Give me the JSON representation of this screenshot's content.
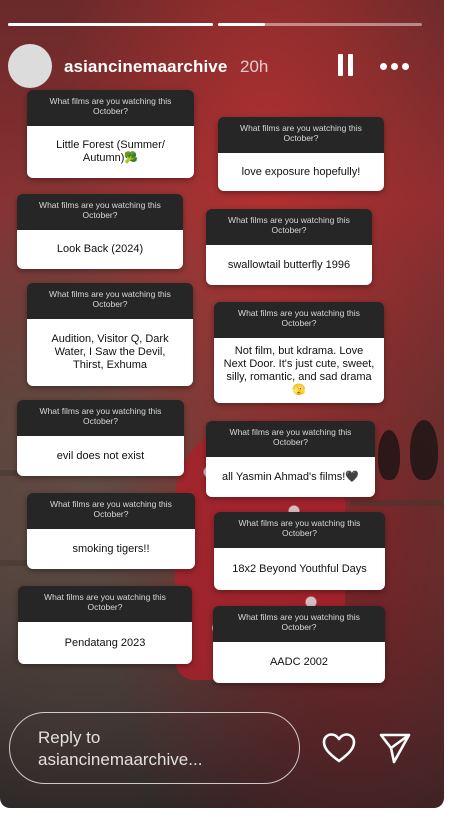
{
  "story": {
    "username": "asiancinemaarchive",
    "time_ago": "20h",
    "progress": [
      1.0,
      0.25
    ]
  },
  "question": "What films are you watching this October?",
  "cards": [
    {
      "answer": "Little Forest (Summer/ Autumn)🥦"
    },
    {
      "answer": "love exposure hopefully!"
    },
    {
      "answer": "Look Back (2024)"
    },
    {
      "answer": "swallowtail butterfly 1996"
    },
    {
      "answer": "Audition, Visitor Q, Dark Water, I Saw the Devil, Thirst, Exhuma"
    },
    {
      "answer": "Not film, but kdrama. Love Next Door. It's just cute, sweet, silly, romantic, and sad drama 🫣"
    },
    {
      "answer": "evil does not exist"
    },
    {
      "answer": "all Yasmin Ahmad's films!🖤"
    },
    {
      "answer": "smoking tigers!!"
    },
    {
      "answer": "18x2 Beyond Youthful Days"
    },
    {
      "answer": "Pendatang 2023"
    },
    {
      "answer": "AADC 2002"
    }
  ],
  "reply": {
    "placeholder": "Reply to asiancinemaarchive..."
  },
  "icons": {
    "pause": "pause-icon",
    "more": "more-icon",
    "like": "heart-icon",
    "share": "send-icon"
  }
}
